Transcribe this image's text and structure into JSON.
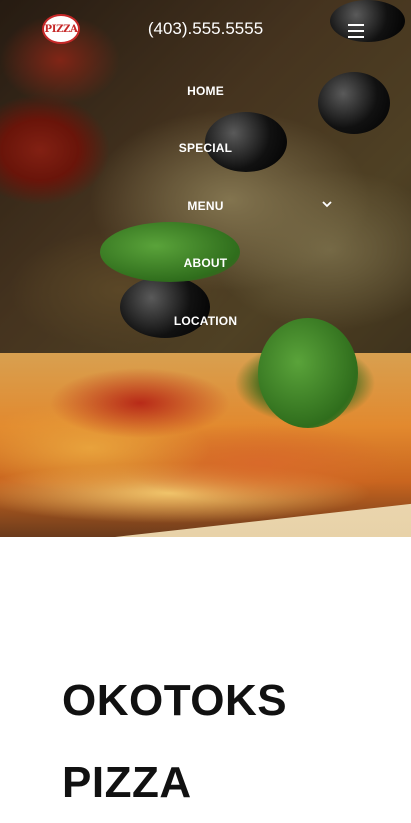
{
  "header": {
    "logo_text": "PIZZA",
    "phone": "(403).555.5555"
  },
  "nav": {
    "items": [
      {
        "label": "HOME"
      },
      {
        "label": "SPECIAL"
      },
      {
        "label": "MENU"
      },
      {
        "label": "ABOUT"
      },
      {
        "label": "LOCATION"
      }
    ]
  },
  "main": {
    "title": "OKOTOKS PIZZA"
  },
  "colors": {
    "logo_red": "#c62828",
    "nav_text": "#ffffff",
    "title_text": "#111111"
  }
}
